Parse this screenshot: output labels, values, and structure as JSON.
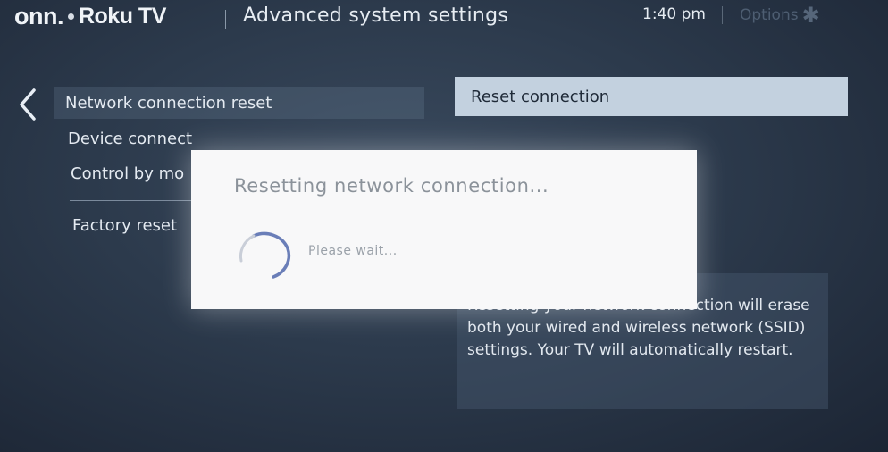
{
  "header": {
    "brand_onn": "onn.",
    "brand_roku": "Roku TV",
    "title": "Advanced system settings",
    "time": "1:40 pm",
    "options_label": "Options"
  },
  "menu": {
    "items": [
      {
        "label": "Network connection reset",
        "selected": true
      },
      {
        "label": "Device connect",
        "selected": false
      },
      {
        "label": "Control by mo",
        "selected": false
      },
      {
        "label": "Factory reset",
        "selected": false
      }
    ]
  },
  "action": {
    "button_label": "Reset connection"
  },
  "info": {
    "text": "Resetting your network connection will erase both your wired and wireless network (SSID) settings. Your TV will automatically restart."
  },
  "dialog": {
    "title": "Resetting network connection...",
    "message": "Please wait..."
  },
  "icons": {
    "back": "chevron-left-icon",
    "options": "asterisk-icon",
    "spinner": "loading-spinner-icon"
  },
  "colors": {
    "background": "#2c3a4c",
    "selected_button": "#c3d1df",
    "dialog": "#f8f8f9",
    "spinner": "#5a6fae"
  }
}
